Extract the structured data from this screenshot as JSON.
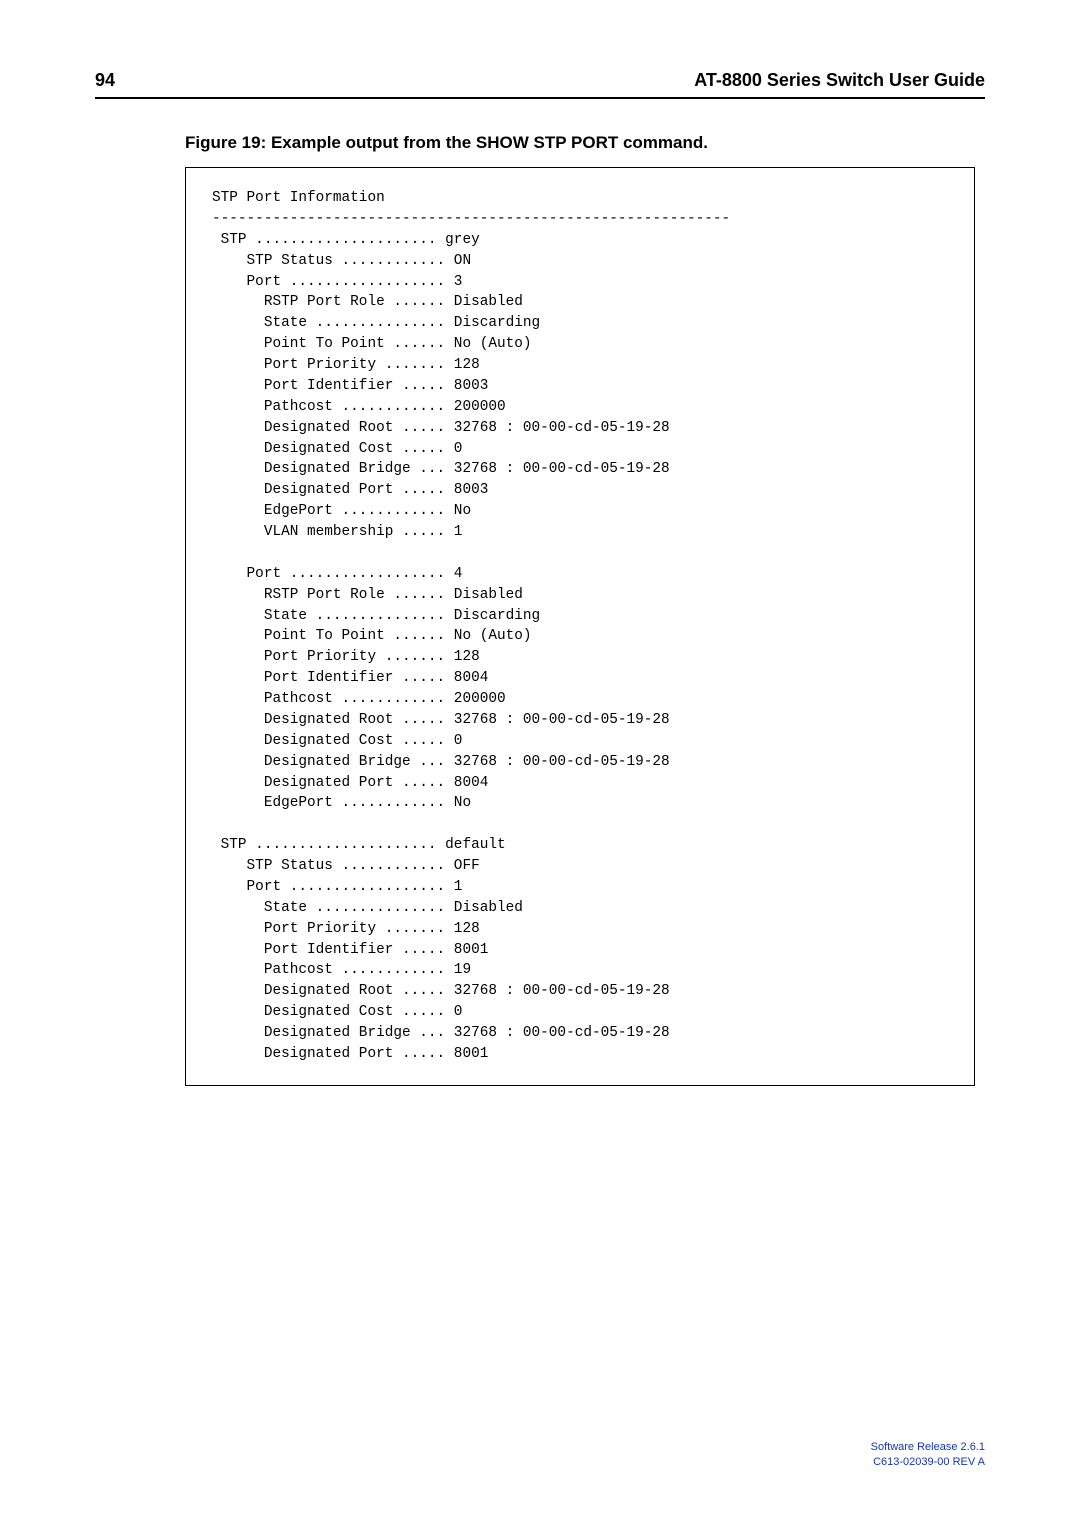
{
  "header": {
    "page_number": "94",
    "guide_title": "AT-8800 Series Switch User Guide"
  },
  "figure_caption": "Figure 19: Example output from the SHOW STP PORT command.",
  "code_block": "STP Port Information\n------------------------------------------------------------\n STP ..................... grey\n    STP Status ............ ON\n    Port .................. 3\n      RSTP Port Role ...... Disabled\n      State ............... Discarding\n      Point To Point ...... No (Auto)\n      Port Priority ....... 128\n      Port Identifier ..... 8003\n      Pathcost ............ 200000\n      Designated Root ..... 32768 : 00-00-cd-05-19-28\n      Designated Cost ..... 0\n      Designated Bridge ... 32768 : 00-00-cd-05-19-28\n      Designated Port ..... 8003\n      EdgePort ............ No\n      VLAN membership ..... 1\n\n    Port .................. 4\n      RSTP Port Role ...... Disabled\n      State ............... Discarding\n      Point To Point ...... No (Auto)\n      Port Priority ....... 128\n      Port Identifier ..... 8004\n      Pathcost ............ 200000\n      Designated Root ..... 32768 : 00-00-cd-05-19-28\n      Designated Cost ..... 0\n      Designated Bridge ... 32768 : 00-00-cd-05-19-28\n      Designated Port ..... 8004\n      EdgePort ............ No\n\n STP ..................... default\n    STP Status ............ OFF\n    Port .................. 1\n      State ............... Disabled\n      Port Priority ....... 128\n      Port Identifier ..... 8001\n      Pathcost ............ 19\n      Designated Root ..... 32768 : 00-00-cd-05-19-28\n      Designated Cost ..... 0\n      Designated Bridge ... 32768 : 00-00-cd-05-19-28\n      Designated Port ..... 8001",
  "footer": {
    "line1": "Software Release 2.6.1",
    "line2": "C613-02039-00 REV A"
  }
}
